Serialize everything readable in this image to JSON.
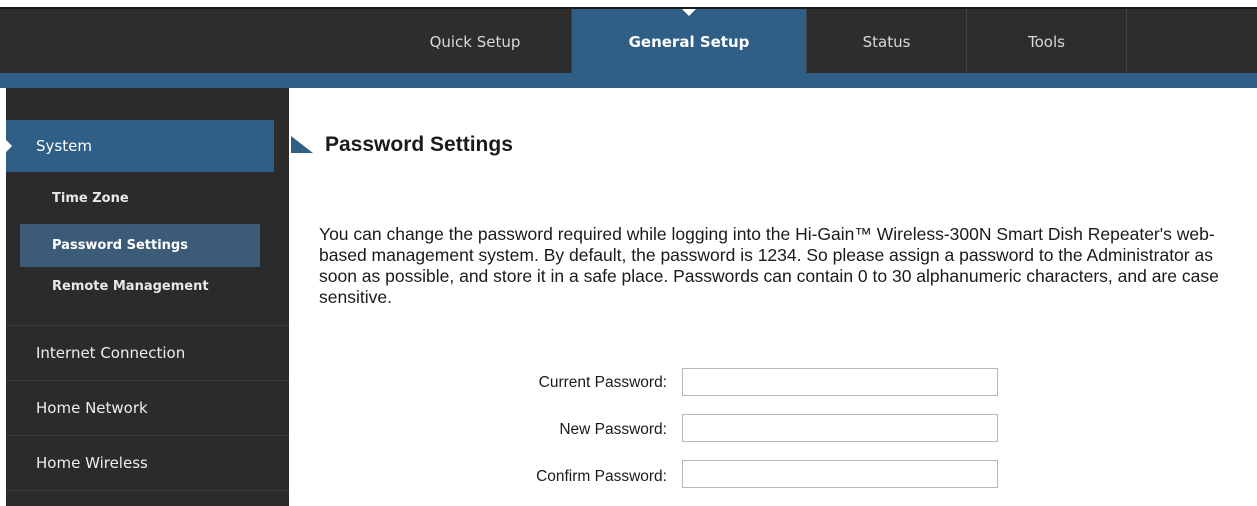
{
  "nav": {
    "tabs": [
      {
        "label": "Quick Setup",
        "active": false
      },
      {
        "label": "General Setup",
        "active": true
      },
      {
        "label": "Status",
        "active": false
      },
      {
        "label": "Tools",
        "active": false
      }
    ]
  },
  "sidebar": {
    "system": "System",
    "time_zone": "Time Zone",
    "password_settings": "Password Settings",
    "remote_management": "Remote Management",
    "internet_connection": "Internet Connection",
    "home_network": "Home Network",
    "home_wireless": "Home Wireless"
  },
  "main": {
    "title": "Password Settings",
    "description": "You can change the password required while logging into the Hi-Gain™ Wireless-300N Smart Dish Repeater's web-based management system. By default, the password is 1234. So please assign a password to the Administrator as soon as possible, and store it in a safe place. Passwords can contain 0 to 30 alphanumeric characters, and are case sensitive.",
    "form": {
      "current_label": "Current Password:",
      "current_value": "",
      "new_label": "New Password:",
      "new_value": "",
      "confirm_label": "Confirm Password:",
      "confirm_value": ""
    }
  },
  "colors": {
    "accent": "#2f5f86",
    "nav_bg": "#2d2d2d",
    "sidebar_bg": "#2b2b2b"
  }
}
